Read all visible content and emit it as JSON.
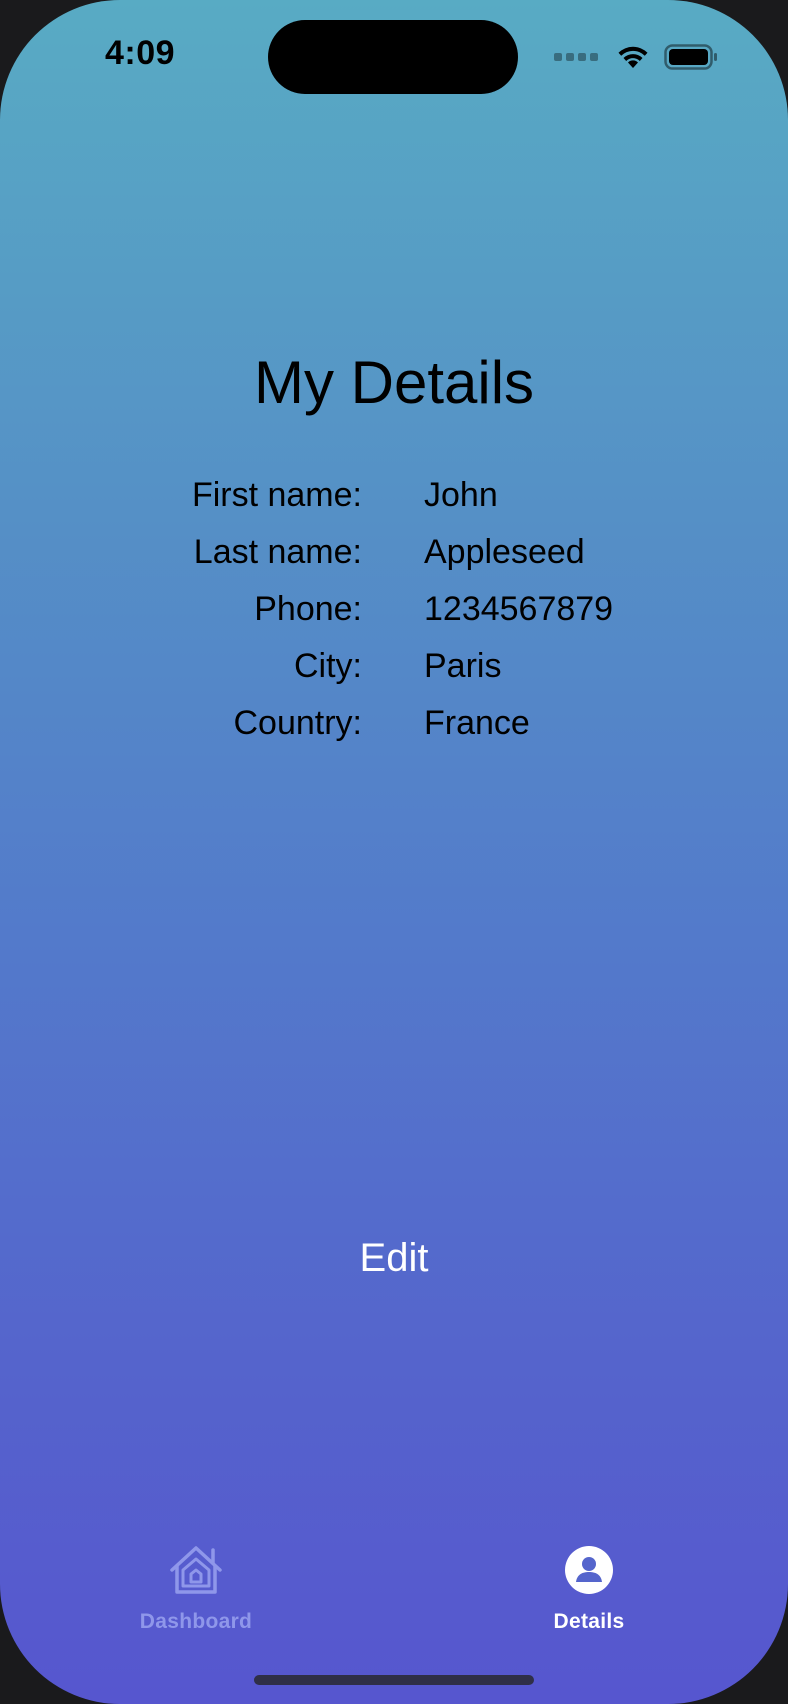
{
  "status_bar": {
    "time": "4:09"
  },
  "page": {
    "title": "My Details"
  },
  "details": [
    {
      "label": "First name:",
      "value": "John"
    },
    {
      "label": "Last name:",
      "value": "Appleseed"
    },
    {
      "label": "Phone:",
      "value": "1234567879"
    },
    {
      "label": "City:",
      "value": "Paris"
    },
    {
      "label": "Country:",
      "value": "France"
    }
  ],
  "actions": {
    "edit_label": "Edit"
  },
  "tab_bar": {
    "tabs": [
      {
        "label": "Dashboard",
        "icon": "house-icon",
        "selected": false
      },
      {
        "label": "Details",
        "icon": "person-circle-icon",
        "selected": true
      }
    ]
  },
  "colors": {
    "gradient_top": "#58abc4",
    "gradient_bottom": "#5656cf",
    "tab_active": "#ffffff",
    "tab_inactive": "#8f97ea",
    "edit_text": "#ffffff"
  }
}
